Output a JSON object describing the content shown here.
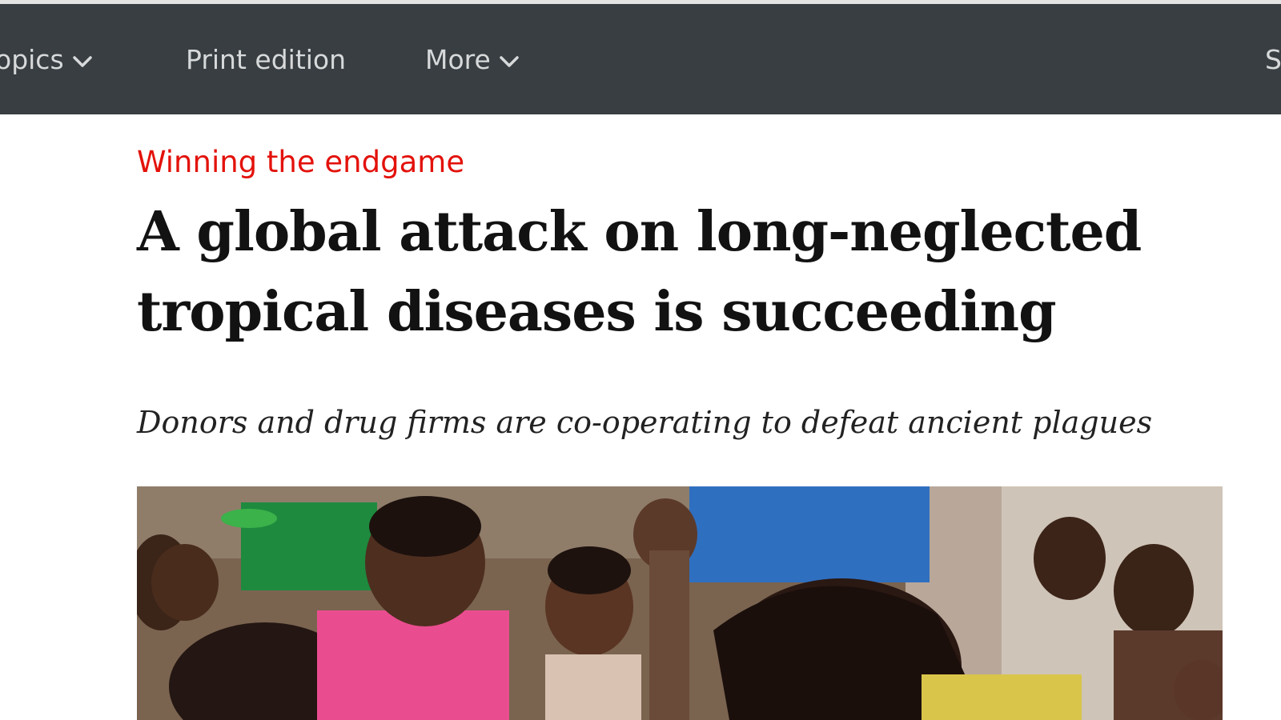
{
  "nav": {
    "items": [
      {
        "label": "opics",
        "has_dropdown": true
      },
      {
        "label": "Print edition",
        "has_dropdown": false
      },
      {
        "label": "More",
        "has_dropdown": true
      },
      {
        "label": "S",
        "has_dropdown": false
      }
    ],
    "chevron_icon": "chevron-down-icon"
  },
  "article": {
    "rubric": "Winning the endgame",
    "headline": "A global attack on long-neglected tropical diseases is succeeding",
    "subheadline": "Donors and drug firms are co-operating to defeat ancient plagues",
    "hero_image": "photo-children-crowd"
  },
  "colors": {
    "nav_bg": "#383e42",
    "nav_text": "#d7d9da",
    "rubric_red": "#e3120b",
    "headline_text": "#121212"
  }
}
